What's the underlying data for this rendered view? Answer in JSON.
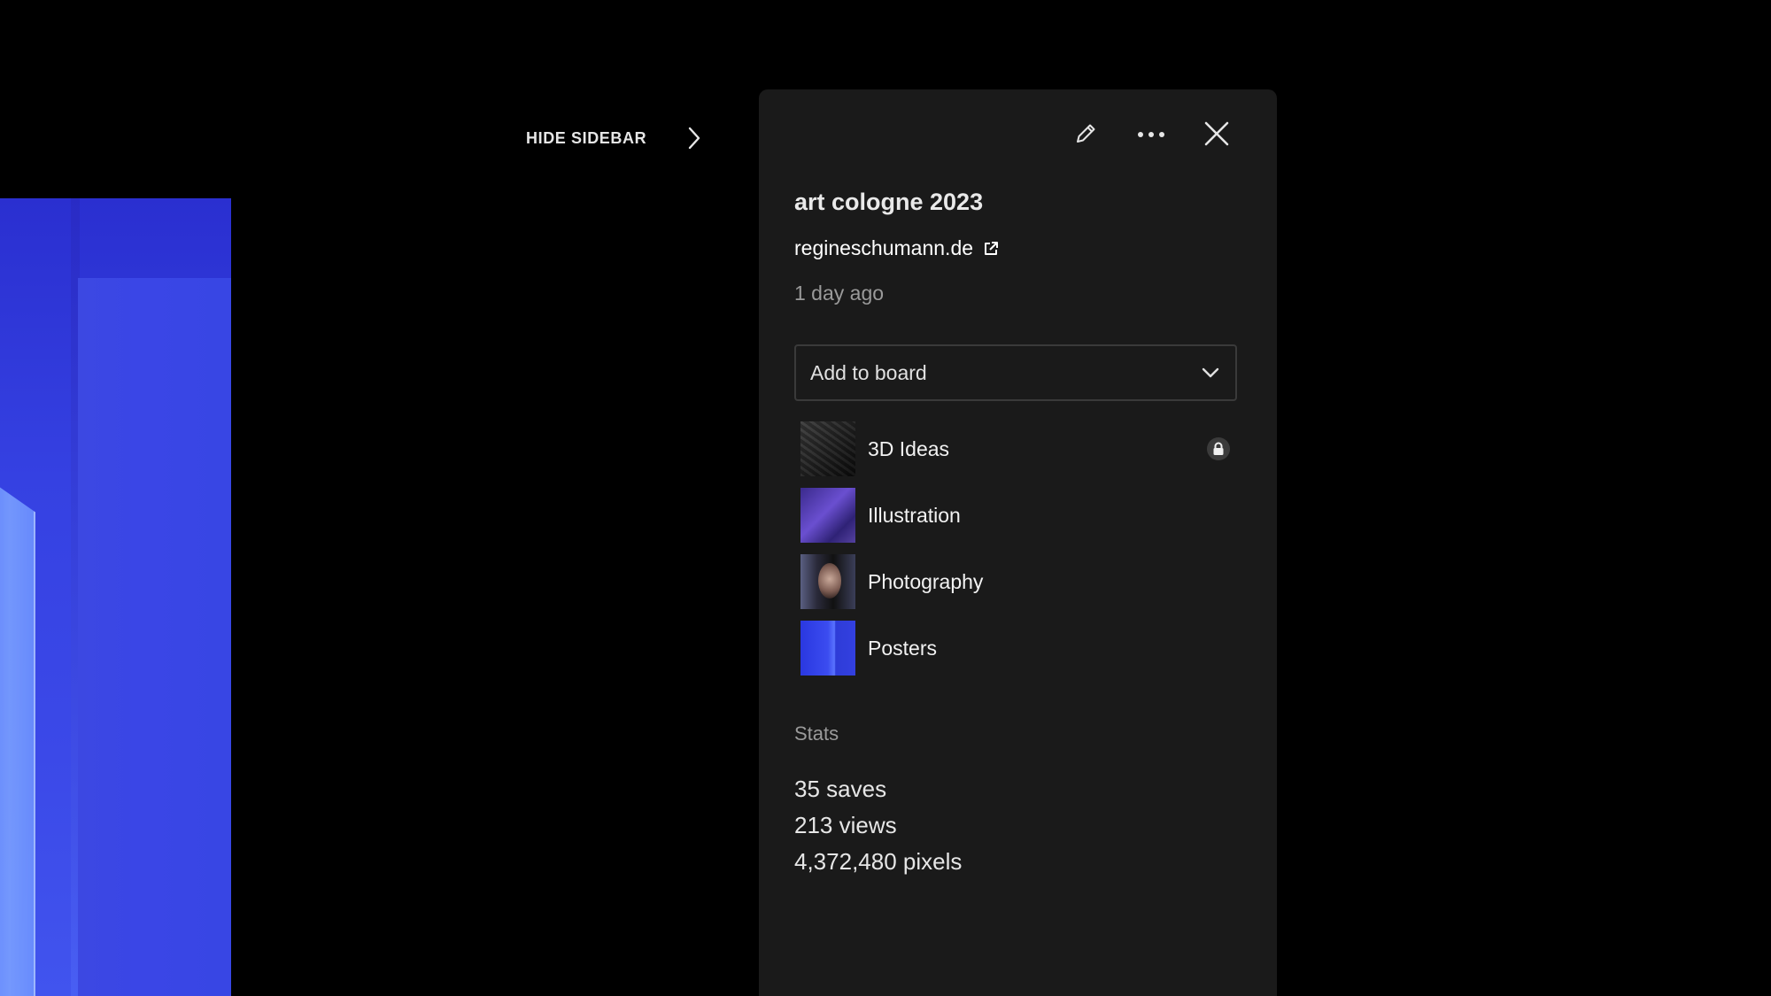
{
  "sidebar_toggle": {
    "label": "HIDE SIDEBAR",
    "icon": "chevron-right-icon"
  },
  "toolbar": {
    "edit_icon": "pencil-icon",
    "more_icon": "more-dots-icon",
    "close_icon": "close-icon"
  },
  "item": {
    "title": "art cologne 2023",
    "source": "regineschumann.de",
    "source_icon": "external-link-icon",
    "age": "1 day ago"
  },
  "board_select": {
    "value": "Add to board",
    "icon": "chevron-down-icon"
  },
  "boards": [
    {
      "name": "3D Ideas",
      "private": true,
      "icon": "lock-icon"
    },
    {
      "name": "Illustration",
      "private": false
    },
    {
      "name": "Photography",
      "private": false
    },
    {
      "name": "Posters",
      "private": false
    }
  ],
  "stats": {
    "heading": "Stats",
    "saves": "35 saves",
    "views": "213 views",
    "pixels": "4,372,480 pixels"
  },
  "colors": {
    "page_background": "#000000",
    "panel_background": "#1a1a1a",
    "preview_blue": "#3b49e8",
    "muted_text": "#9a9a9a"
  }
}
